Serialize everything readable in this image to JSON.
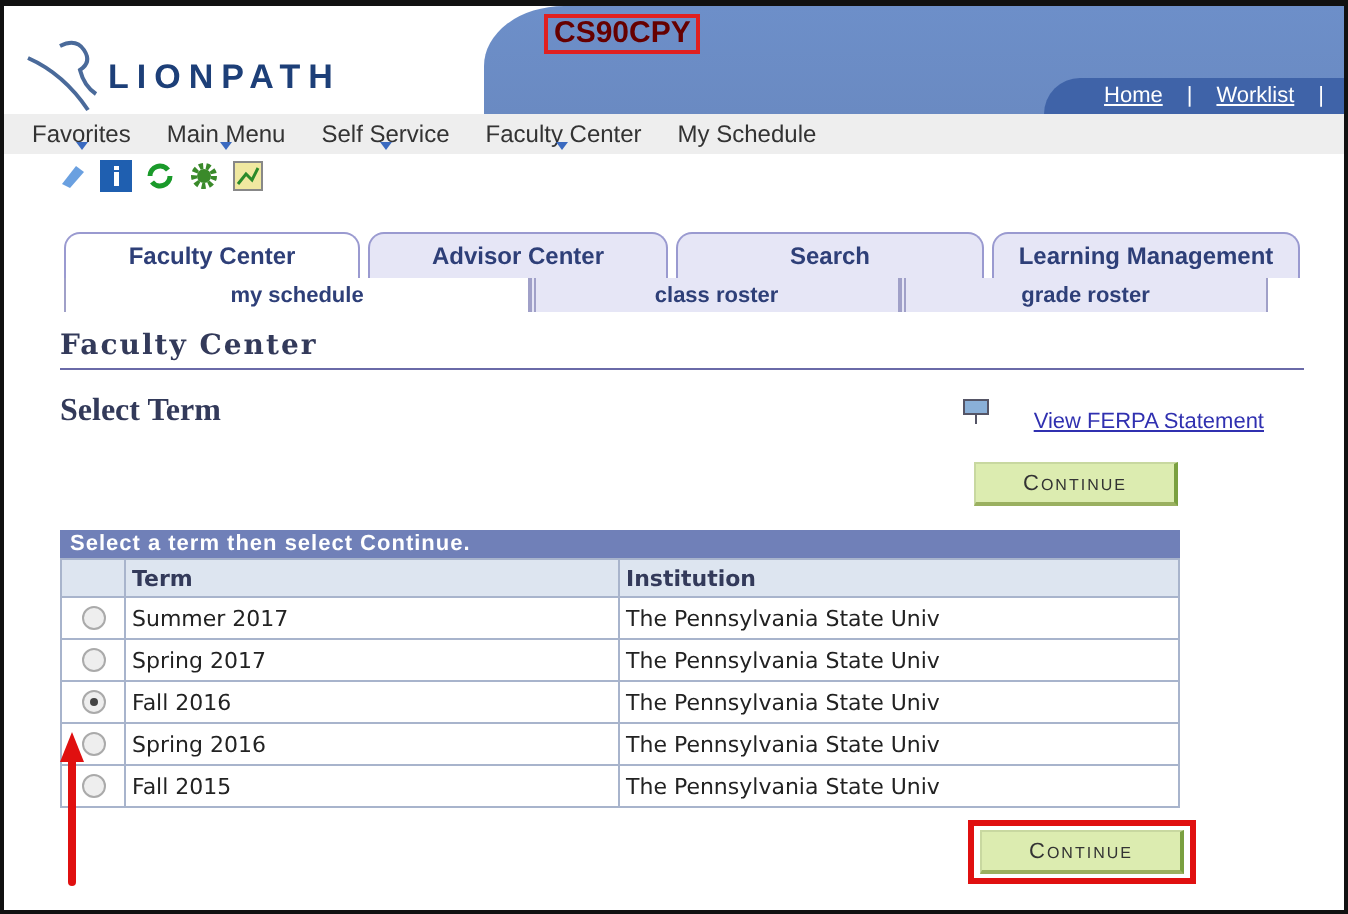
{
  "header": {
    "logo": "LIONPATH",
    "system_code": "CS90CPY",
    "links": [
      {
        "label": "Home",
        "separator": "|"
      },
      {
        "label": "Worklist",
        "separator": "|"
      }
    ]
  },
  "breadcrumbs": [
    {
      "label": "Favorites",
      "menu": true
    },
    {
      "label": "Main Menu",
      "menu": true
    },
    {
      "label": "Self Service",
      "menu": true
    },
    {
      "label": "Faculty Center",
      "menu": true
    },
    {
      "label": "My Schedule",
      "menu": false
    }
  ],
  "tabs": [
    {
      "label": "Faculty Center",
      "selected": true
    },
    {
      "label": "Advisor Center",
      "selected": false
    },
    {
      "label": "Search",
      "selected": false
    },
    {
      "label": "Learning Management",
      "selected": false
    }
  ],
  "subtabs": [
    {
      "label": "my schedule",
      "selected": true
    },
    {
      "label": "class roster",
      "selected": false
    },
    {
      "label": "grade roster",
      "selected": false
    }
  ],
  "section_title": "Faculty Center",
  "page_title": "Select Term",
  "ferpa_link": "View FERPA Statement",
  "continue_top": "Continue",
  "table": {
    "caption": "Select a term then select Continue.",
    "columns": [
      "Term",
      "Institution"
    ],
    "rows": [
      {
        "term": "Summer 2017",
        "institution": "The Pennsylvania State Univ",
        "selected": false
      },
      {
        "term": "Spring 2017",
        "institution": "The Pennsylvania State Univ",
        "selected": false
      },
      {
        "term": "Fall 2016",
        "institution": "The Pennsylvania State Univ",
        "selected": true
      },
      {
        "term": "Spring 2016",
        "institution": "The Pennsylvania State Univ",
        "selected": false
      },
      {
        "term": "Fall 2015",
        "institution": "The Pennsylvania State Univ",
        "selected": false
      }
    ]
  },
  "continue_bottom": "Continue"
}
